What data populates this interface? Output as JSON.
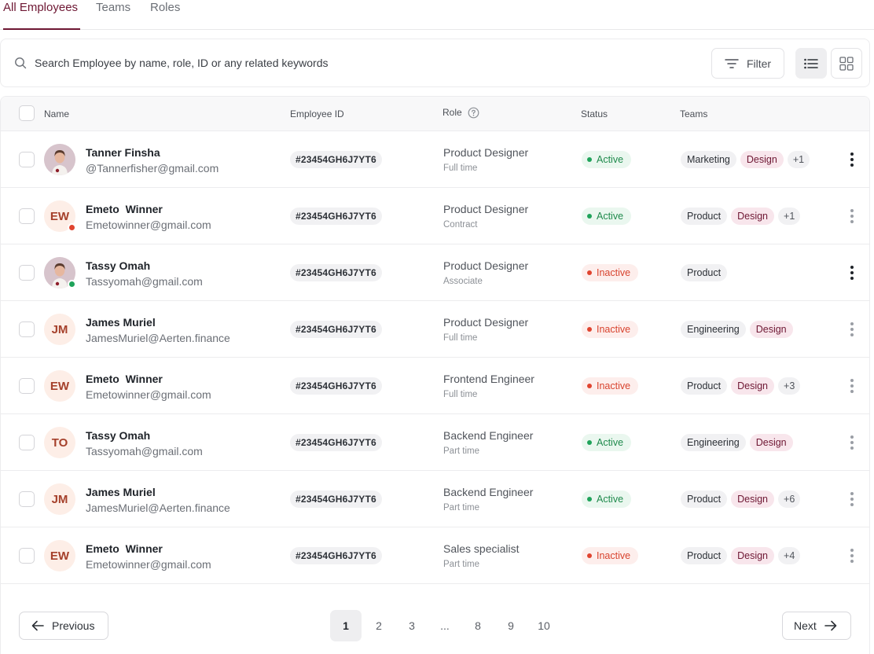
{
  "tabs": [
    {
      "label": "All Employees"
    },
    {
      "label": "Teams"
    },
    {
      "label": "Roles"
    }
  ],
  "search": {
    "placeholder": "Search Employee by name, role, ID or any related keywords",
    "filter_label": "Filter"
  },
  "table": {
    "headers": {
      "name": "Name",
      "employee_id": "Employee ID",
      "role": "Role",
      "status": "Status",
      "teams": "Teams"
    },
    "rows": [
      {
        "name": "Tanner Finsha",
        "email": "@Tannerfisher@gmail.com",
        "avatar": "photo",
        "initials": "",
        "presence": "",
        "id": "#23454GH6J7YT6",
        "role": "Product Designer",
        "role_type": "Full time",
        "status": "Active",
        "teams": [
          "Marketing",
          "Design"
        ],
        "more": "+1"
      },
      {
        "name": "Emeto  Winner",
        "email": "Emetowinner@gmail.com",
        "avatar": "initials",
        "initials": "EW",
        "presence": "red",
        "id": "#23454GH6J7YT6",
        "role": "Product Designer",
        "role_type": "Contract",
        "status": "Active",
        "teams": [
          "Product",
          "Design"
        ],
        "more": "+1"
      },
      {
        "name": "Tassy Omah",
        "email": "Tassyomah@gmail.com",
        "avatar": "photo",
        "initials": "",
        "presence": "green",
        "id": "#23454GH6J7YT6",
        "role": "Product Designer",
        "role_type": "Associate",
        "status": "Inactive",
        "teams": [
          "Product"
        ],
        "more": ""
      },
      {
        "name": "James Muriel",
        "email": "JamesMuriel@Aerten.finance",
        "avatar": "initials",
        "initials": "JM",
        "presence": "",
        "id": "#23454GH6J7YT6",
        "role": "Product Designer",
        "role_type": "Full time",
        "status": "Inactive",
        "teams": [
          "Engineering",
          "Design"
        ],
        "more": ""
      },
      {
        "name": "Emeto  Winner",
        "email": "Emetowinner@gmail.com",
        "avatar": "initials",
        "initials": "EW",
        "presence": "",
        "id": "#23454GH6J7YT6",
        "role": "Frontend Engineer",
        "role_type": "Full time",
        "status": "Inactive",
        "teams": [
          "Product",
          "Design"
        ],
        "more": "+3"
      },
      {
        "name": "Tassy Omah",
        "email": "Tassyomah@gmail.com",
        "avatar": "initials",
        "initials": "TO",
        "presence": "",
        "id": "#23454GH6J7YT6",
        "role": "Backend Engineer",
        "role_type": "Part time",
        "status": "Active",
        "teams": [
          "Engineering",
          "Design"
        ],
        "more": ""
      },
      {
        "name": "James Muriel",
        "email": "JamesMuriel@Aerten.finance",
        "avatar": "initials",
        "initials": "JM",
        "presence": "",
        "id": "#23454GH6J7YT6",
        "role": "Backend Engineer",
        "role_type": "Part time",
        "status": "Active",
        "teams": [
          "Product",
          "Design"
        ],
        "more": "+6"
      },
      {
        "name": "Emeto  Winner",
        "email": "Emetowinner@gmail.com",
        "avatar": "initials",
        "initials": "EW",
        "presence": "",
        "id": "#23454GH6J7YT6",
        "role": "Sales specialist",
        "role_type": "Part time",
        "status": "Inactive",
        "teams": [
          "Product",
          "Design"
        ],
        "more": "+4"
      }
    ]
  },
  "pagination": {
    "previous_label": "Previous",
    "next_label": "Next",
    "pages": [
      "1",
      "2",
      "3",
      "...",
      "8",
      "9",
      "10"
    ],
    "current": "1"
  },
  "colors": {
    "accent": "#6e1733",
    "active": "#1fa35a",
    "inactive": "#e0442f"
  }
}
